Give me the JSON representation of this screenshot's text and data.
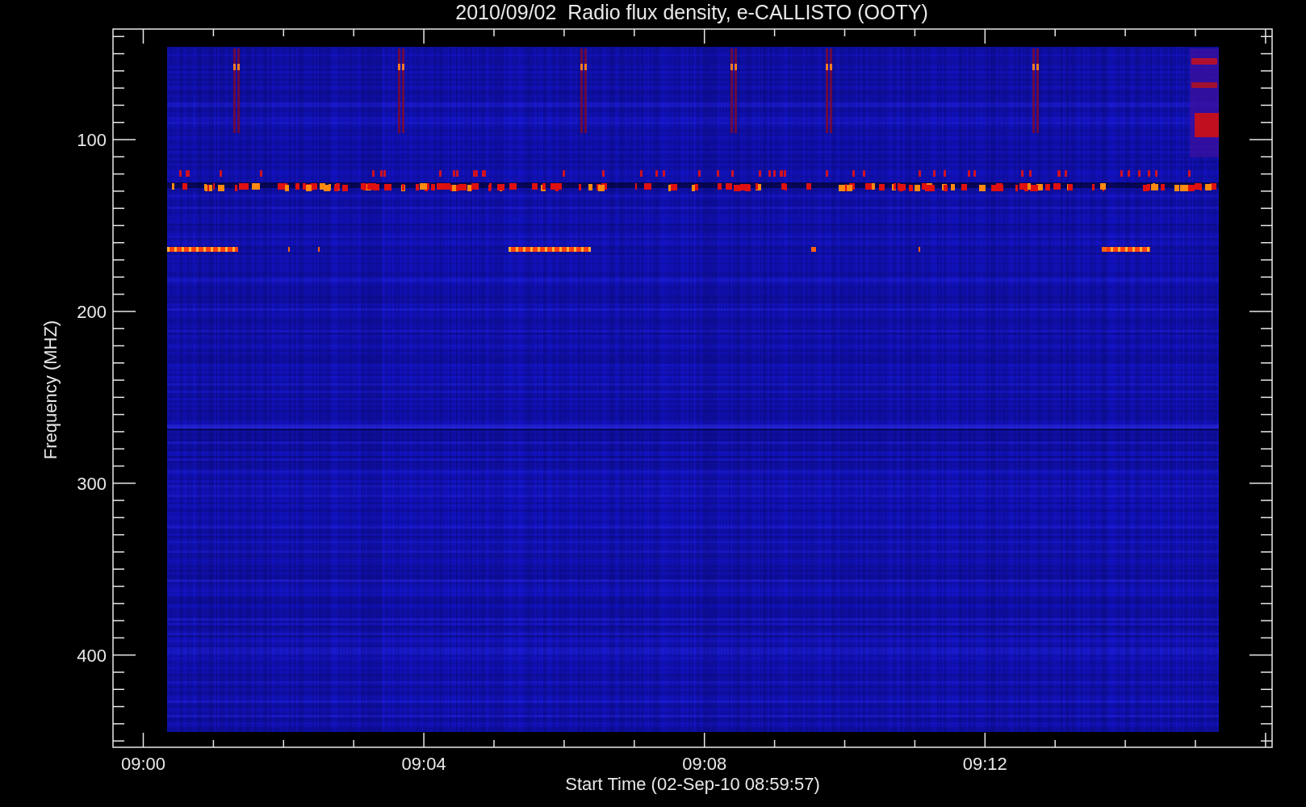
{
  "title": "2010/09/02  Radio flux density, e-CALLISTO (OOTY)",
  "xlabel": "Start Time (02-Sep-10 08:59:57)",
  "ylabel": "Frequency (MHZ)",
  "xticks": [
    "09:00",
    "09:04",
    "09:08",
    "09:12"
  ],
  "yticks": [
    "100",
    "200",
    "300",
    "400"
  ]
}
